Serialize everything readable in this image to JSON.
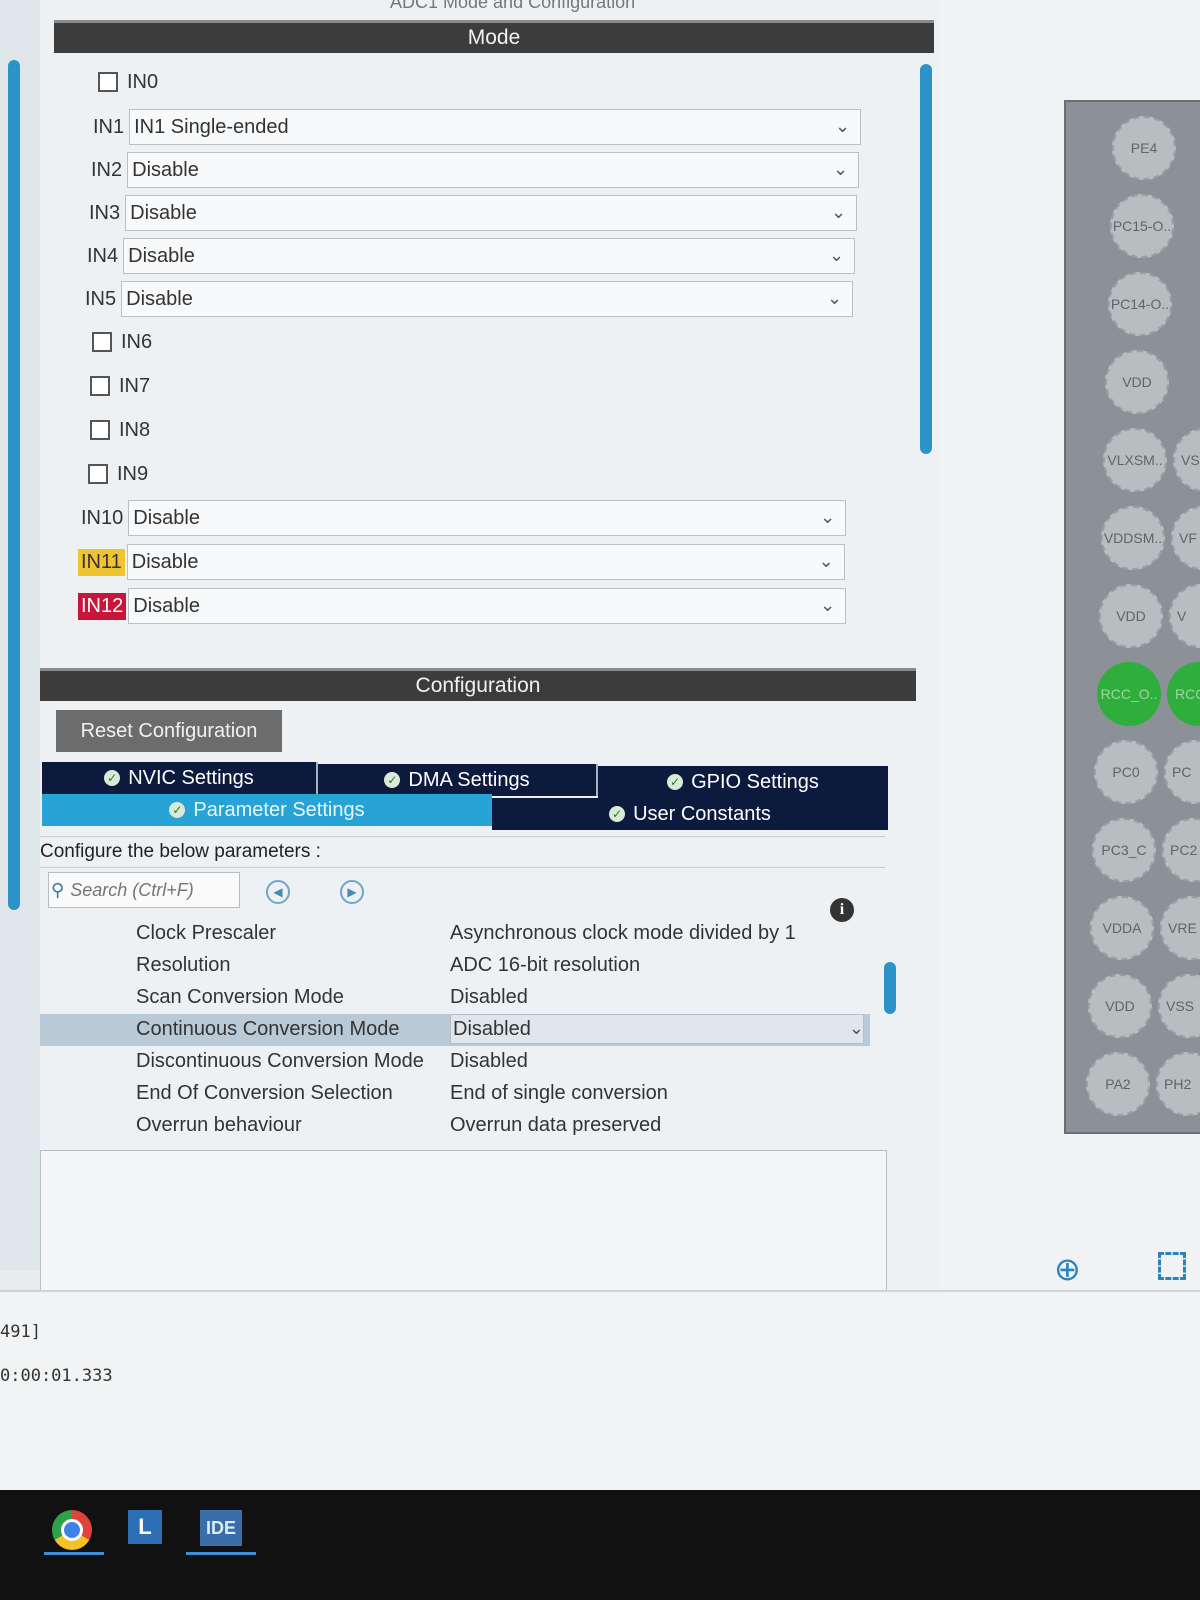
{
  "window": {
    "title": "ADC1 Mode and Configuration"
  },
  "mode": {
    "header": "Mode",
    "channels": [
      {
        "label": "IN0",
        "kind": "checkbox",
        "checked": false
      },
      {
        "label": "IN1",
        "kind": "select",
        "value": "IN1 Single-ended"
      },
      {
        "label": "IN2",
        "kind": "select",
        "value": "Disable"
      },
      {
        "label": "IN3",
        "kind": "select",
        "value": "Disable"
      },
      {
        "label": "IN4",
        "kind": "select",
        "value": "Disable"
      },
      {
        "label": "IN5",
        "kind": "select",
        "value": "Disable"
      },
      {
        "label": "IN6",
        "kind": "checkbox",
        "checked": false
      },
      {
        "label": "IN7",
        "kind": "checkbox",
        "checked": false
      },
      {
        "label": "IN8",
        "kind": "checkbox",
        "checked": false
      },
      {
        "label": "IN9",
        "kind": "checkbox",
        "checked": false
      },
      {
        "label": "IN10",
        "kind": "select",
        "value": "Disable"
      },
      {
        "label": "IN11",
        "kind": "select",
        "value": "Disable",
        "highlight": "#f0c430"
      },
      {
        "label": "IN12",
        "kind": "select",
        "value": "Disable",
        "highlight": "#c8153a"
      }
    ]
  },
  "configuration": {
    "header": "Configuration",
    "reset_button": "Reset Configuration",
    "tabs": {
      "nvic": "NVIC Settings",
      "dma": "DMA Settings",
      "gpio": "GPIO Settings",
      "parameter": "Parameter Settings",
      "user_constants": "User Constants"
    },
    "description": "Configure the below parameters :",
    "search_placeholder": "Search (Ctrl+F)",
    "parameters": [
      {
        "name": "Clock Prescaler",
        "value": "Asynchronous clock mode divided by 1"
      },
      {
        "name": "Resolution",
        "value": "ADC 16-bit resolution"
      },
      {
        "name": "Scan Conversion Mode",
        "value": "Disabled"
      },
      {
        "name": "Continuous Conversion Mode",
        "value": "Disabled",
        "selected": true
      },
      {
        "name": "Discontinuous Conversion Mode",
        "value": "Disabled"
      },
      {
        "name": "End Of Conversion Selection",
        "value": "End of single conversion"
      },
      {
        "name": "Overrun behaviour",
        "value": "Overrun data preserved"
      }
    ]
  },
  "pinout": {
    "pins_col1": [
      "PE4",
      "PC15-O..",
      "PC14-O..",
      "VDD",
      "VLXSM..",
      "VDDSM..",
      "VDD",
      "RCC_O..",
      "PC0",
      "PC3_C",
      "VDDA",
      "VDD",
      "PA2"
    ],
    "pins_col2": [
      "",
      "",
      "",
      "",
      "VS",
      "VF",
      "V",
      "RCC",
      "PC",
      "PC2",
      "VRE",
      "VSS",
      "PH2"
    ],
    "active_color": "#2fae3e"
  },
  "console": {
    "lines": [
      "491]",
      "0:00:01.333"
    ]
  },
  "taskbar": {
    "apps": [
      {
        "name": "chrome-icon"
      },
      {
        "label": "L"
      },
      {
        "label": "IDE"
      }
    ]
  },
  "colors": {
    "accent": "#27a3d6",
    "tab_dark": "#0c1a3e",
    "header_dark": "#3c3c3c"
  }
}
